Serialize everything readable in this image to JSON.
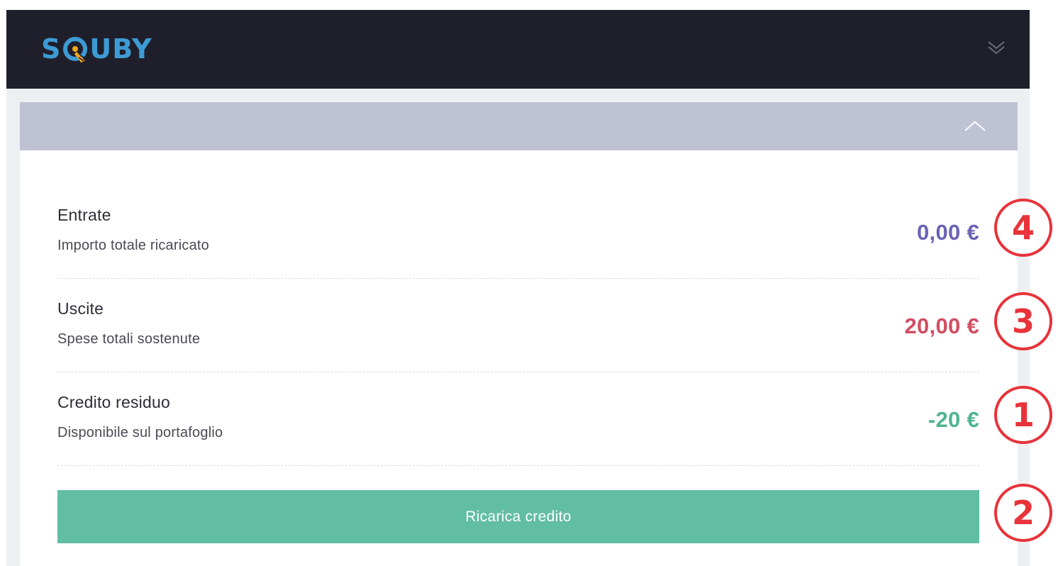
{
  "navbar": {
    "logo_text_left": "s",
    "logo_text_right": "uby",
    "logo_full": "SQUBY",
    "brand_color": "#3d9bd4",
    "logo_accent_color": "#f2a51e",
    "toggle_icon": "double-chevron-down-icon",
    "background": "#1f1f2b"
  },
  "panel": {
    "header_background": "#bec2d3",
    "collapse_icon": "chevron-up-icon"
  },
  "summary": {
    "rows": [
      {
        "title": "Entrate",
        "subtitle": "Importo totale ricaricato",
        "amount": "0,00 €",
        "amount_color": "#6b63b5"
      },
      {
        "title": "Uscite",
        "subtitle": "Spese totali sostenute",
        "amount": "20,00 €",
        "amount_color": "#d24d62"
      },
      {
        "title": "Credito residuo",
        "subtitle": "Disponibile sul portafoglio",
        "amount": "-20 €",
        "amount_color": "#4fb58f"
      }
    ]
  },
  "actions": {
    "recharge_label": "Ricarica credito",
    "recharge_color": "#62bea3"
  },
  "annotations": {
    "badges": [
      "4",
      "3",
      "1",
      "2"
    ],
    "badge_color": "#e8333a"
  }
}
